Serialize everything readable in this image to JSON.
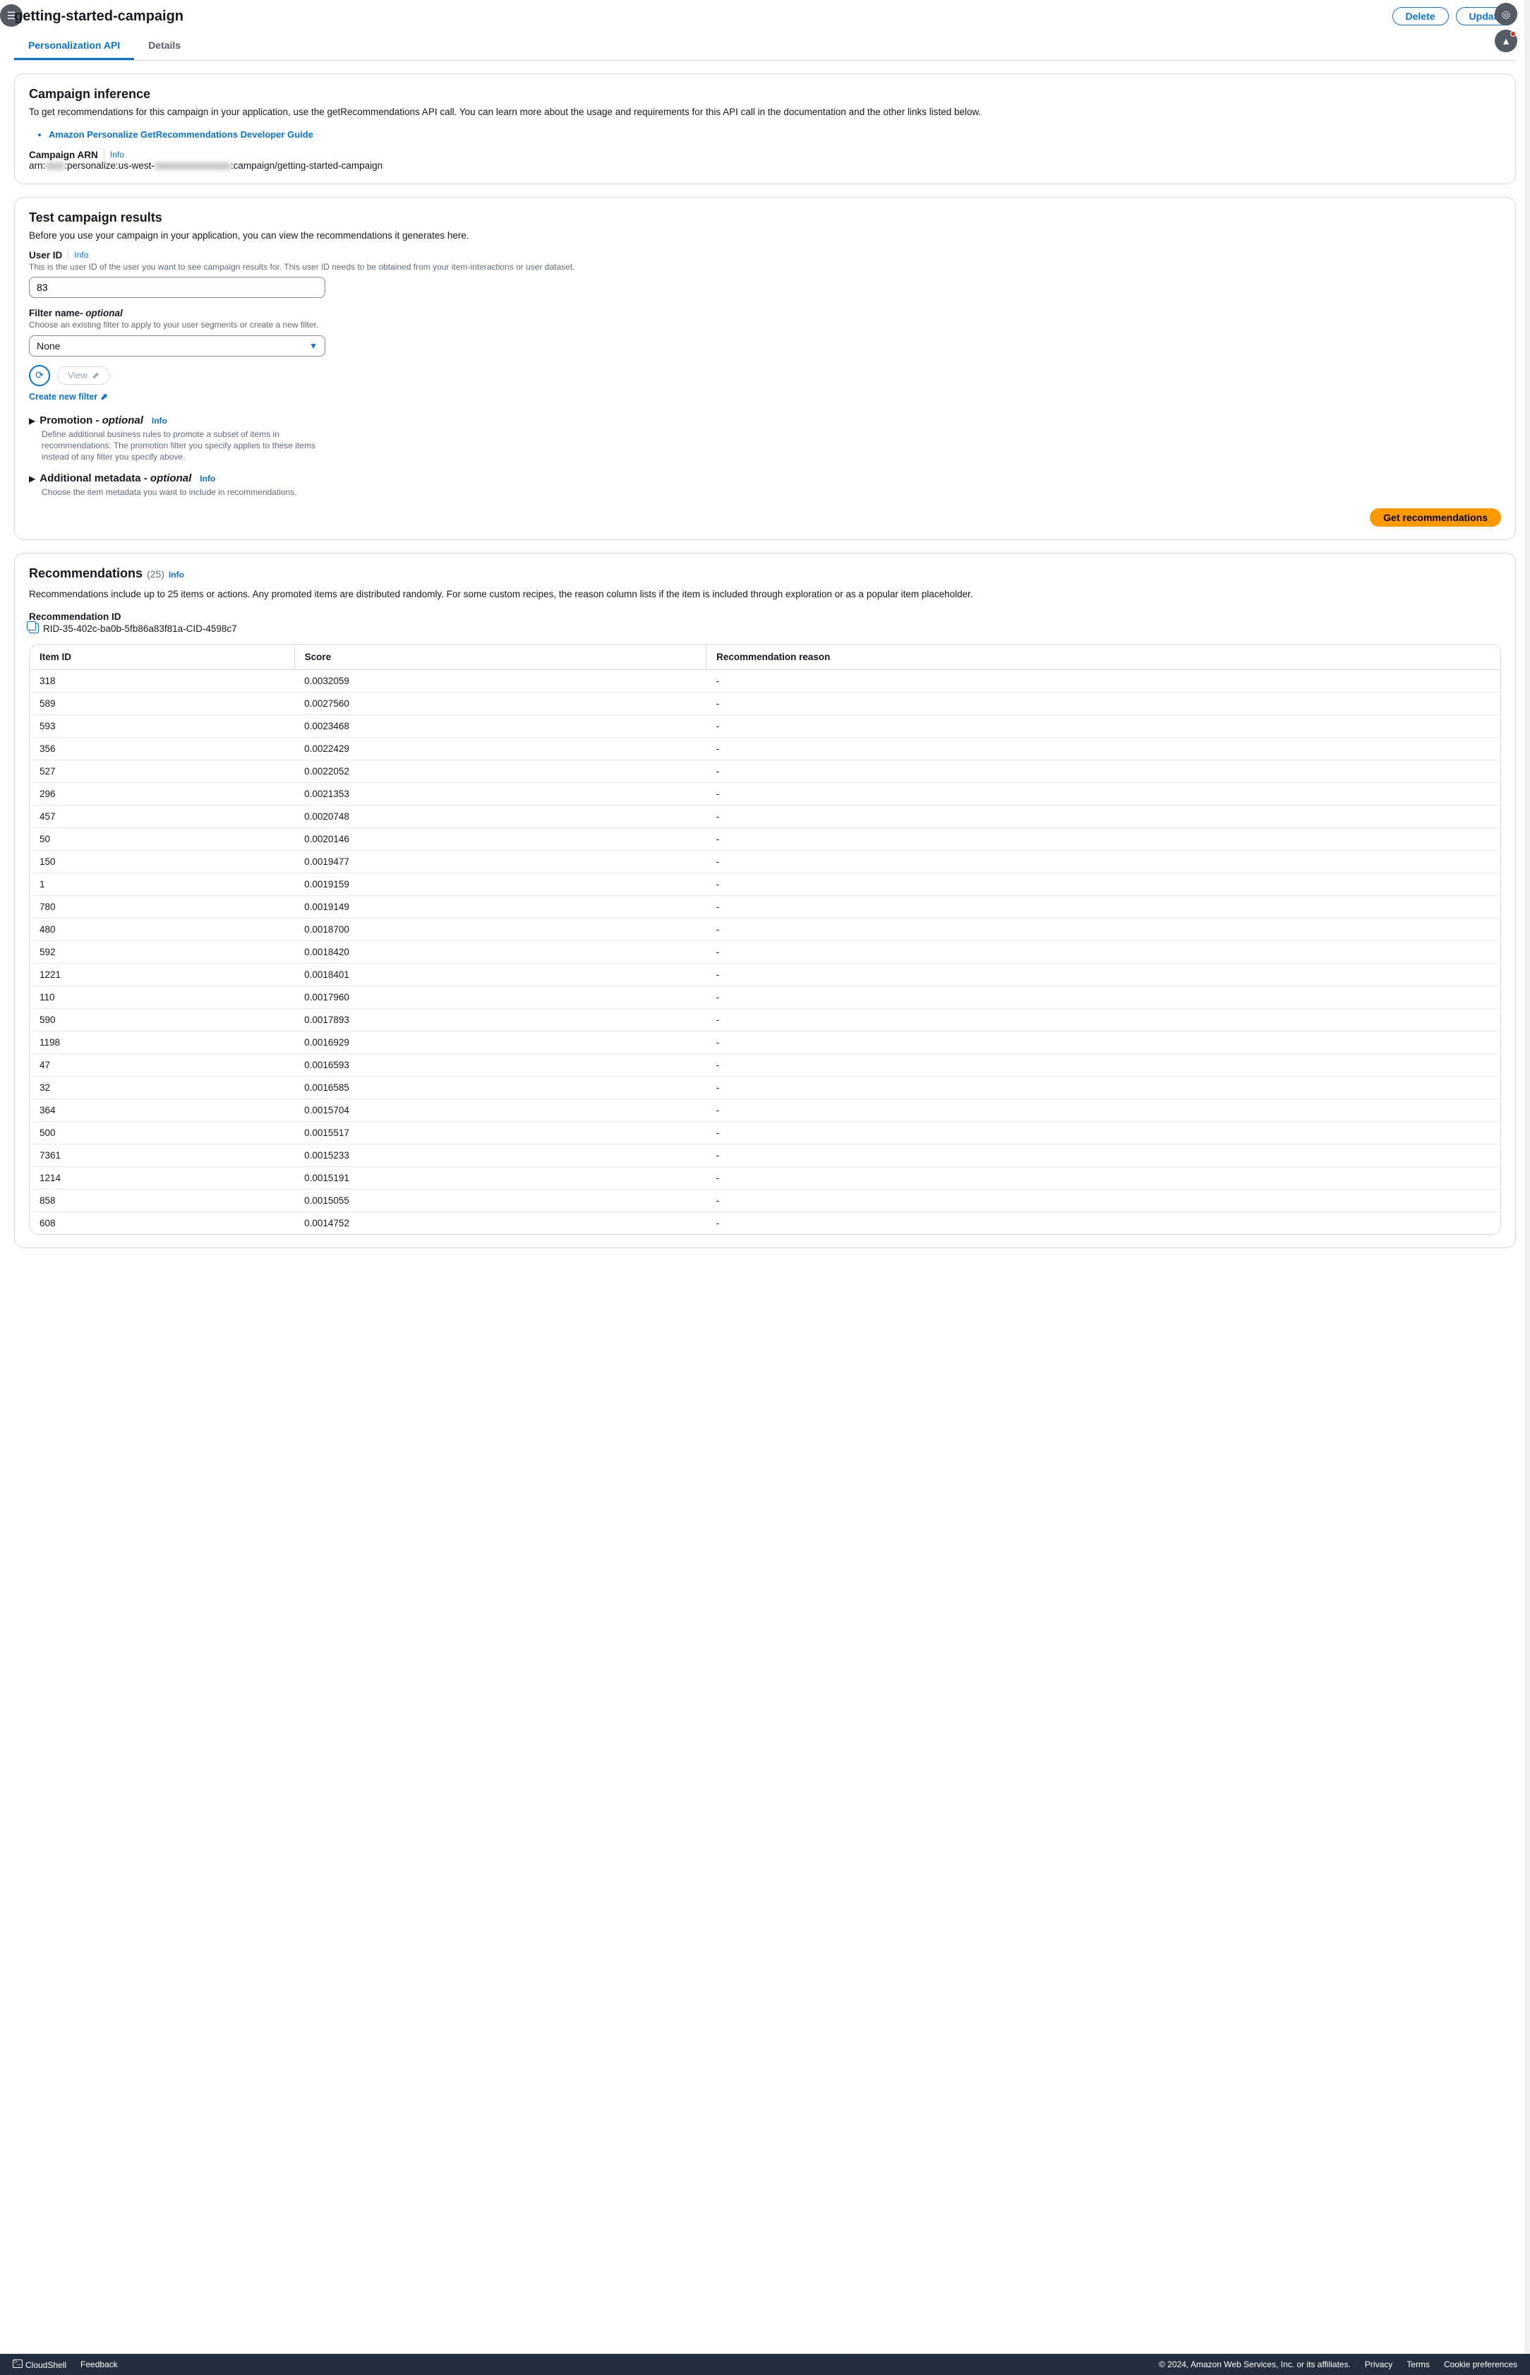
{
  "header": {
    "title": "getting-started-campaign",
    "delete_label": "Delete",
    "update_label": "Update"
  },
  "tabs": {
    "personalization": "Personalization API",
    "details": "Details"
  },
  "campaign_inference": {
    "title": "Campaign inference",
    "desc": "To get recommendations for this campaign in your application, use the getRecommendations API call. You can learn more about the usage and requirements for this API call in the documentation and the other links listed below.",
    "guide_link": "Amazon Personalize GetRecommendations Developer Guide",
    "arn_label": "Campaign ARN",
    "arn_info": "Info",
    "arn_prefix": "arn:",
    "arn_masked": "xxxx",
    "arn_mid": ":personalize:us-west-",
    "arn_masked2": "xxxxxxxxxxxxxxxx",
    "arn_suffix": ":campaign/getting-started-campaign"
  },
  "test": {
    "title": "Test campaign results",
    "desc": "Before you use your campaign in your application, you can view the recommendations it generates here.",
    "user_id_label": "User ID",
    "user_id_info": "Info",
    "user_id_hint": "This is the user ID of the user you want to see campaign results for. This user ID needs to be obtained from your item-interactions or user dataset.",
    "user_id_value": "83",
    "filter_label": "Filter name",
    "filter_opt": "- optional",
    "filter_hint": "Choose an existing filter to apply to your user segments or create a new filter.",
    "filter_value": "None",
    "view_label": "View",
    "create_filter": "Create new filter",
    "promotion_title": "Promotion -",
    "promotion_opt": "optional",
    "promotion_info": "Info",
    "promotion_desc": "Define additional business rules to promote a subset of items in recommendations. The promotion filter you specify applies to these items instead of any filter you specify above.",
    "metadata_title": "Additional metadata -",
    "metadata_opt": "optional",
    "metadata_info": "Info",
    "metadata_desc": "Choose the item metadata you want to include in recommendations.",
    "get_recs": "Get recommendations"
  },
  "recommendations": {
    "title": "Recommendations",
    "count": "(25)",
    "info": "Info",
    "desc": "Recommendations include up to 25 items or actions. Any promoted items are distributed randomly. For some custom recipes, the reason column lists if the item is included through exploration or as a popular item placeholder.",
    "rec_id_label": "Recommendation ID",
    "rec_id_value": "RID-35-402c-ba0b-5fb86a83f81a-CID-4598c7",
    "columns": {
      "item": "Item ID",
      "score": "Score",
      "reason": "Recommendation reason"
    },
    "rows": [
      {
        "item": "318",
        "score": "0.0032059",
        "reason": "-"
      },
      {
        "item": "589",
        "score": "0.0027560",
        "reason": "-"
      },
      {
        "item": "593",
        "score": "0.0023468",
        "reason": "-"
      },
      {
        "item": "356",
        "score": "0.0022429",
        "reason": "-"
      },
      {
        "item": "527",
        "score": "0.0022052",
        "reason": "-"
      },
      {
        "item": "296",
        "score": "0.0021353",
        "reason": "-"
      },
      {
        "item": "457",
        "score": "0.0020748",
        "reason": "-"
      },
      {
        "item": "50",
        "score": "0.0020146",
        "reason": "-"
      },
      {
        "item": "150",
        "score": "0.0019477",
        "reason": "-"
      },
      {
        "item": "1",
        "score": "0.0019159",
        "reason": "-"
      },
      {
        "item": "780",
        "score": "0.0019149",
        "reason": "-"
      },
      {
        "item": "480",
        "score": "0.0018700",
        "reason": "-"
      },
      {
        "item": "592",
        "score": "0.0018420",
        "reason": "-"
      },
      {
        "item": "1221",
        "score": "0.0018401",
        "reason": "-"
      },
      {
        "item": "110",
        "score": "0.0017960",
        "reason": "-"
      },
      {
        "item": "590",
        "score": "0.0017893",
        "reason": "-"
      },
      {
        "item": "1198",
        "score": "0.0016929",
        "reason": "-"
      },
      {
        "item": "47",
        "score": "0.0016593",
        "reason": "-"
      },
      {
        "item": "32",
        "score": "0.0016585",
        "reason": "-"
      },
      {
        "item": "364",
        "score": "0.0015704",
        "reason": "-"
      },
      {
        "item": "500",
        "score": "0.0015517",
        "reason": "-"
      },
      {
        "item": "7361",
        "score": "0.0015233",
        "reason": "-"
      },
      {
        "item": "1214",
        "score": "0.0015191",
        "reason": "-"
      },
      {
        "item": "858",
        "score": "0.0015055",
        "reason": "-"
      },
      {
        "item": "608",
        "score": "0.0014752",
        "reason": "-"
      }
    ]
  },
  "footer": {
    "cloudshell": "CloudShell",
    "feedback": "Feedback",
    "copyright": "© 2024, Amazon Web Services, Inc. or its affiliates.",
    "privacy": "Privacy",
    "terms": "Terms",
    "cookie": "Cookie preferences"
  }
}
